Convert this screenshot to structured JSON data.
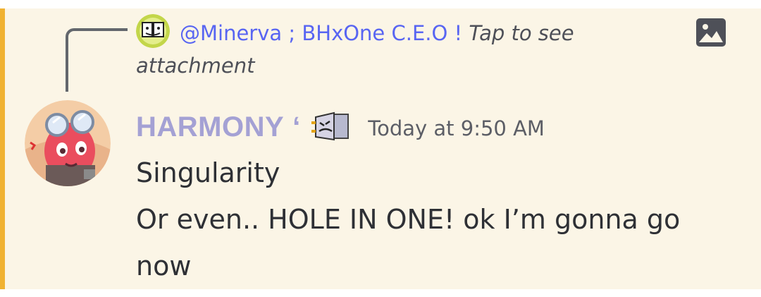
{
  "reply": {
    "author": "@Minerva ; BHxOne C.E.O",
    "separator": "!",
    "hint": "Tap to see attachment"
  },
  "message": {
    "username": "HARMONY",
    "name_suffix": "‘",
    "timestamp": "Today at 9:50 AM",
    "lines": [
      "Singularity",
      "Or even.. HOLE IN ONE! ok I’m gonna go now"
    ]
  },
  "icons": {
    "reply_avatar": "reply-avatar-icon",
    "attachment": "image-attachment-icon",
    "badge": "character-badge-icon",
    "avatar": "user-avatar"
  },
  "colors": {
    "mention_highlight": "#fbf5e6",
    "mention_bar": "#f0b232",
    "reply_author": "#5865f2",
    "username": "#a4a1d4"
  }
}
